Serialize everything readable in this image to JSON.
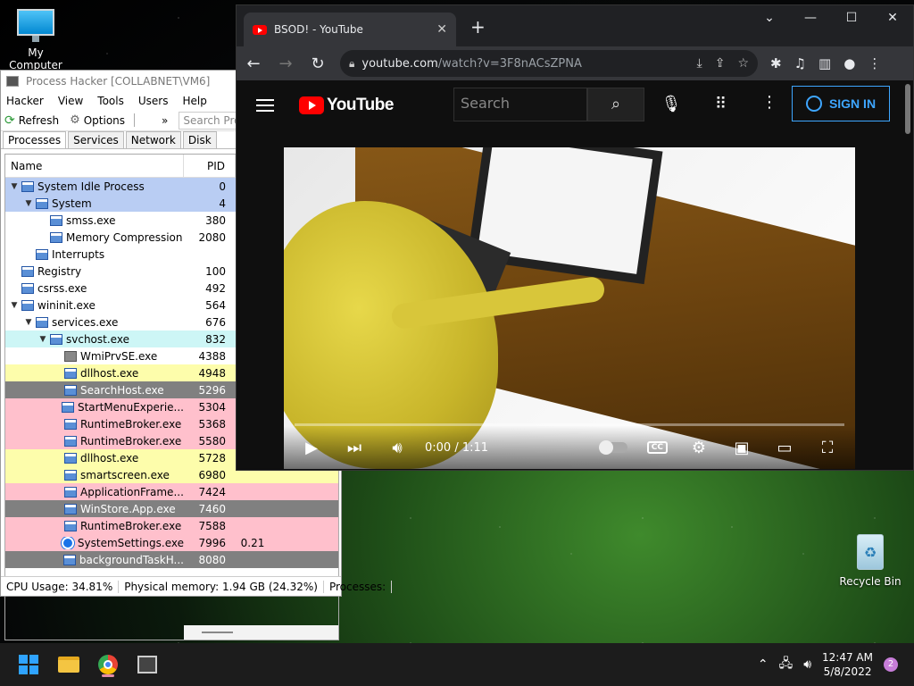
{
  "desktop": {
    "icons": [
      {
        "label": "My Computer"
      },
      {
        "label": "Recycle Bin"
      }
    ]
  },
  "process_hacker": {
    "title": "Process Hacker [COLLABNET\\VM6]",
    "menu": [
      "Hacker",
      "View",
      "Tools",
      "Users",
      "Help"
    ],
    "toolbar": {
      "refresh": "Refresh",
      "options": "Options",
      "overflow": "»",
      "search_placeholder": "Search Processes (Ctrl+K)"
    },
    "tabs": [
      "Processes",
      "Services",
      "Network",
      "Disk"
    ],
    "columns": {
      "name": "Name",
      "pid": "PID"
    },
    "rows": [
      {
        "indent": 0,
        "expand": "▼",
        "name": "System Idle Process",
        "pid": "0",
        "cpu": "",
        "bg": "#b9cdf3",
        "icon": "proc"
      },
      {
        "indent": 1,
        "expand": "▼",
        "name": "System",
        "pid": "4",
        "cpu": "",
        "bg": "#b9cdf3",
        "icon": "proc"
      },
      {
        "indent": 2,
        "expand": "",
        "name": "smss.exe",
        "pid": "380",
        "cpu": "",
        "bg": "#ffffff",
        "icon": "proc"
      },
      {
        "indent": 2,
        "expand": "",
        "name": "Memory Compression",
        "pid": "2080",
        "cpu": "",
        "bg": "#ffffff",
        "icon": "proc"
      },
      {
        "indent": 1,
        "expand": "",
        "name": "Interrupts",
        "pid": "",
        "cpu": "",
        "bg": "#ffffff",
        "icon": "proc"
      },
      {
        "indent": 0,
        "expand": "",
        "name": "Registry",
        "pid": "100",
        "cpu": "",
        "bg": "#ffffff",
        "icon": "proc"
      },
      {
        "indent": 0,
        "expand": "",
        "name": "csrss.exe",
        "pid": "492",
        "cpu": "",
        "bg": "#ffffff",
        "icon": "proc"
      },
      {
        "indent": 0,
        "expand": "▼",
        "name": "wininit.exe",
        "pid": "564",
        "cpu": "",
        "bg": "#ffffff",
        "icon": "proc"
      },
      {
        "indent": 1,
        "expand": "▼",
        "name": "services.exe",
        "pid": "676",
        "cpu": "",
        "bg": "#ffffff",
        "icon": "proc"
      },
      {
        "indent": 2,
        "expand": "▼",
        "name": "svchost.exe",
        "pid": "832",
        "cpu": "",
        "bg": "#cdf6f6",
        "icon": "proc"
      },
      {
        "indent": 3,
        "expand": "",
        "name": "WmiPrvSE.exe",
        "pid": "4388",
        "cpu": "",
        "bg": "#ffffff",
        "icon": "wmi"
      },
      {
        "indent": 3,
        "expand": "",
        "name": "dllhost.exe",
        "pid": "4948",
        "cpu": "",
        "bg": "#fdfdab",
        "icon": "proc"
      },
      {
        "indent": 3,
        "expand": "",
        "name": "SearchHost.exe",
        "pid": "5296",
        "cpu": "",
        "bg": "#808080",
        "icon": "proc"
      },
      {
        "indent": 3,
        "expand": "",
        "name": "StartMenuExperie...",
        "pid": "5304",
        "cpu": "",
        "bg": "#ffc0cc",
        "icon": "proc"
      },
      {
        "indent": 3,
        "expand": "",
        "name": "RuntimeBroker.exe",
        "pid": "5368",
        "cpu": "",
        "bg": "#ffc0cc",
        "icon": "proc"
      },
      {
        "indent": 3,
        "expand": "",
        "name": "RuntimeBroker.exe",
        "pid": "5580",
        "cpu": "",
        "bg": "#ffc0cc",
        "icon": "proc"
      },
      {
        "indent": 3,
        "expand": "",
        "name": "dllhost.exe",
        "pid": "5728",
        "cpu": "",
        "bg": "#fdfdab",
        "icon": "proc"
      },
      {
        "indent": 3,
        "expand": "",
        "name": "smartscreen.exe",
        "pid": "6980",
        "cpu": "",
        "bg": "#fdfdab",
        "icon": "proc"
      },
      {
        "indent": 3,
        "expand": "",
        "name": "ApplicationFrame...",
        "pid": "7424",
        "cpu": "",
        "bg": "#ffc0cc",
        "icon": "proc"
      },
      {
        "indent": 3,
        "expand": "",
        "name": "WinStore.App.exe",
        "pid": "7460",
        "cpu": "",
        "bg": "#808080",
        "icon": "proc"
      },
      {
        "indent": 3,
        "expand": "",
        "name": "RuntimeBroker.exe",
        "pid": "7588",
        "cpu": "",
        "bg": "#ffc0cc",
        "icon": "proc"
      },
      {
        "indent": 3,
        "expand": "",
        "name": "SystemSettings.exe",
        "pid": "7996",
        "cpu": "0.21",
        "bg": "#ffc0cc",
        "icon": "gear"
      },
      {
        "indent": 3,
        "expand": "",
        "name": "backgroundTaskH...",
        "pid": "8080",
        "cpu": "",
        "bg": "#808080",
        "icon": "proc"
      }
    ],
    "status": {
      "cpu": "CPU Usage: 34.81%",
      "mem": "Physical memory: 1.94 GB (24.32%)",
      "procs": "Processes:"
    }
  },
  "chrome": {
    "tab_title": "BSOD! - YouTube",
    "tab_close": "✕",
    "new_tab": "+",
    "url_host": "youtube.com",
    "url_path": "/watch?v=3F8nACsZPNA"
  },
  "youtube": {
    "logo_text": "YouTube",
    "search_placeholder": "Search",
    "sign_in": "SIGN IN",
    "time": "0:00 / 1:11",
    "cc": "CC"
  },
  "taskbar": {
    "time": "12:47 AM",
    "date": "5/8/2022",
    "notifications": "2"
  },
  "colors": {
    "yt_red": "#ff0000",
    "yt_blue": "#3ea6ff",
    "chrome_dark": "#202124"
  }
}
